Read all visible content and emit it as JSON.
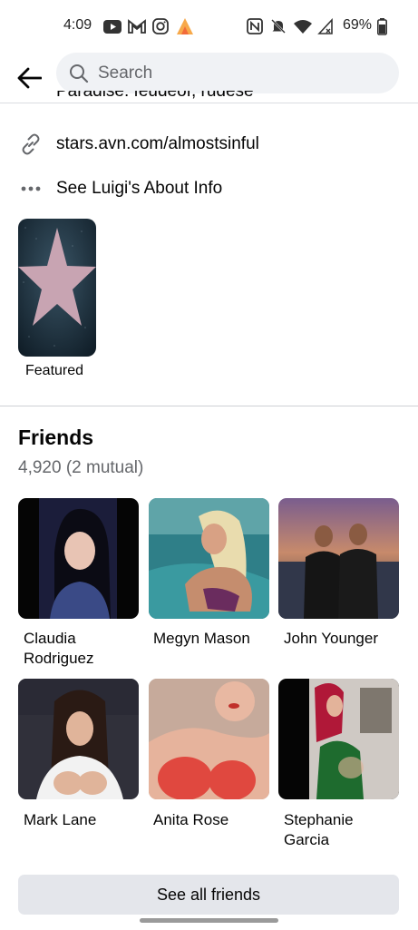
{
  "status_bar": {
    "time": "4:09",
    "battery": "69%",
    "left_icons": [
      "youtube-icon",
      "gmail-icon",
      "instagram-icon",
      "flame-app-icon"
    ],
    "right_icons": [
      "nfc-icon",
      "mute-icon",
      "wifi-icon",
      "signal-icon",
      "battery-icon"
    ]
  },
  "header": {
    "search_placeholder": "Search"
  },
  "intro": {
    "cut_text": "Paradise: feudeof, rudese",
    "website": "stars.avn.com/almostsinful",
    "about_link": "See Luigi's About Info"
  },
  "featured": {
    "label": "Featured"
  },
  "friends": {
    "title": "Friends",
    "count": "4,920 (2 mutual)",
    "see_all": "See all friends",
    "items": [
      {
        "name": "Claudia Rodriguez"
      },
      {
        "name": "Megyn Mason"
      },
      {
        "name": "John Younger"
      },
      {
        "name": "Mark Lane"
      },
      {
        "name": "Anita Rose"
      },
      {
        "name": "Stephanie Garcia"
      }
    ]
  },
  "colors": {
    "search_bg": "#f0f2f5",
    "secondary_text": "#65676b",
    "button_bg": "#e4e6eb"
  }
}
